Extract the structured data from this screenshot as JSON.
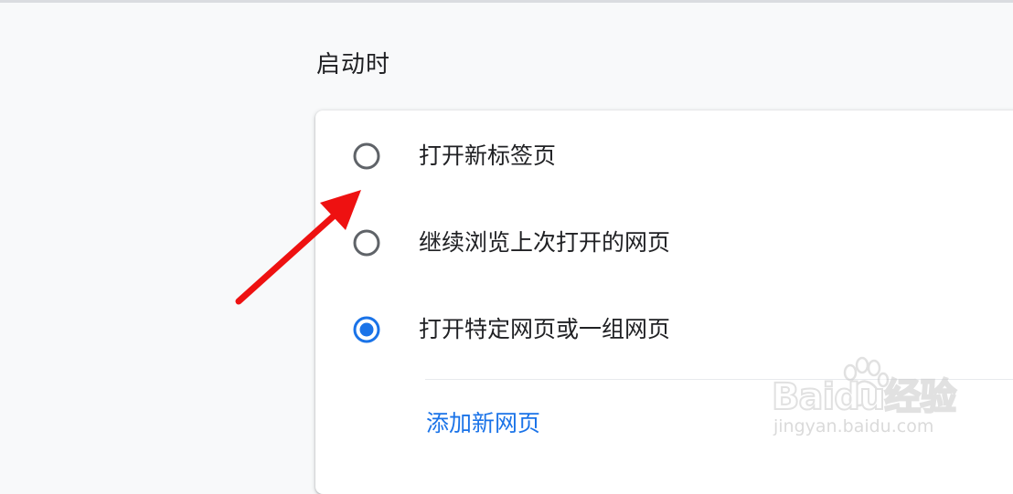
{
  "section": {
    "title": "启动时"
  },
  "startup_options": [
    {
      "label": "打开新标签页",
      "selected": false
    },
    {
      "label": "继续浏览上次打开的网页",
      "selected": false
    },
    {
      "label": "打开特定网页或一组网页",
      "selected": true
    }
  ],
  "add_page_link": "添加新网页",
  "colors": {
    "accent": "#1a73e8",
    "radio_unselected": "#5f6368",
    "annotation_arrow": "#ee1111"
  },
  "watermark": {
    "brand": "Baidu经验",
    "url": "jingyan.baidu.com"
  }
}
